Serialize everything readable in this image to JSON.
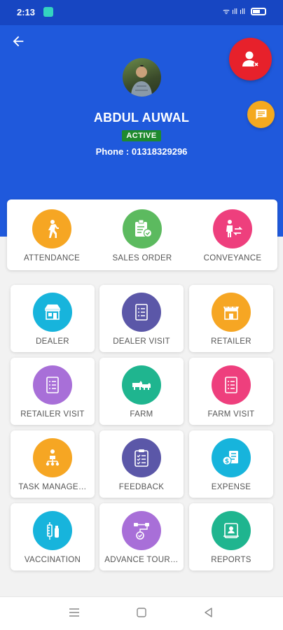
{
  "status_bar": {
    "time": "2:13",
    "signal_text": "ᯤ ıll ıll"
  },
  "profile": {
    "name": "ABDUL AUWAL",
    "status": "ACTIVE",
    "phone_label": "Phone : 01318329296"
  },
  "quick_actions": [
    {
      "label": "ATTENDANCE",
      "color": "#f6a623",
      "icon": "walking-person-icon"
    },
    {
      "label": "SALES ORDER",
      "color": "#5cba5f",
      "icon": "clipboard-order-icon"
    },
    {
      "label": "CONVEYANCE",
      "color": "#ee3f7d",
      "icon": "person-transfer-icon"
    }
  ],
  "grid": [
    {
      "label": "DEALER",
      "color": "#17b4dc",
      "icon": "shop-icon"
    },
    {
      "label": "DEALER VISIT",
      "color": "#5b57a8",
      "icon": "checklist-icon"
    },
    {
      "label": "RETAILER",
      "color": "#f6a623",
      "icon": "store-icon"
    },
    {
      "label": "RETAILER VISIT",
      "color": "#a86fd8",
      "icon": "checklist-icon"
    },
    {
      "label": "FARM",
      "color": "#1fb58f",
      "icon": "livestock-icon"
    },
    {
      "label": "FARM VISIT",
      "color": "#ee3f7d",
      "icon": "checklist-icon"
    },
    {
      "label": "TASK MANAGE…",
      "color": "#f6a623",
      "icon": "team-tasks-icon"
    },
    {
      "label": "FEEDBACK",
      "color": "#5b57a8",
      "icon": "feedback-clipboard-icon"
    },
    {
      "label": "EXPENSE",
      "color": "#17b4dc",
      "icon": "expense-icon"
    },
    {
      "label": "VACCINATION",
      "color": "#17b4dc",
      "icon": "syringe-icon"
    },
    {
      "label": "ADVANCE TOUR…",
      "color": "#a86fd8",
      "icon": "tour-route-icon"
    },
    {
      "label": "REPORTS",
      "color": "#1fb58f",
      "icon": "reports-icon"
    }
  ],
  "colors": {
    "header": "#1f59dc",
    "status_bar": "#1746c2",
    "logout": "#e7212b",
    "chat": "#f4a91f",
    "active_badge": "#1f8a2e"
  }
}
